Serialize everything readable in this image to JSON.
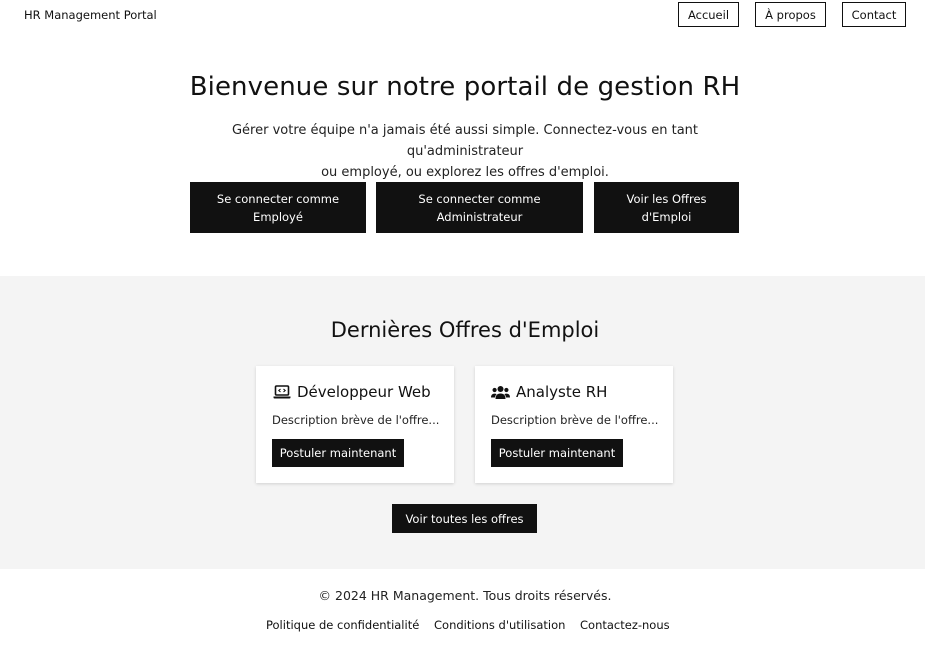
{
  "header": {
    "brand": "HR Management Portal",
    "nav": [
      {
        "label": "Accueil"
      },
      {
        "label": "À propos"
      },
      {
        "label": "Contact"
      }
    ]
  },
  "hero": {
    "title": "Bienvenue sur notre portail de gestion RH",
    "text_line1": "Gérer votre équipe n'a jamais été aussi simple. Connectez-vous en tant qu'administrateur",
    "text_line2": "ou employé, ou explorez les offres d'emploi.",
    "buttons": [
      {
        "line1": "Se connecter comme",
        "line2": "Employé"
      },
      {
        "line1": "Se connecter comme",
        "line2": "Administrateur"
      },
      {
        "line1": "Voir les Offres",
        "line2": "d'Emploi"
      }
    ]
  },
  "jobs": {
    "title": "Dernières Offres d'Emploi",
    "cards": [
      {
        "icon": "laptop-code-icon",
        "title": "Développeur Web",
        "description": "Description brève de l'offre...",
        "button": "Postuler maintenant"
      },
      {
        "icon": "users-icon",
        "title": "Analyste RH",
        "description": "Description brève de l'offre...",
        "button": "Postuler maintenant"
      }
    ],
    "view_all": "Voir toutes les offres"
  },
  "footer": {
    "copyright": "© 2024 HR Management. Tous droits réservés.",
    "links": [
      {
        "label": "Politique de confidentialité"
      },
      {
        "label": "Conditions d'utilisation"
      },
      {
        "label": "Contactez-nous"
      }
    ]
  },
  "colors": {
    "primary": "#111111",
    "section_bg": "#f4f4f4",
    "page_bg": "#ffffff"
  }
}
